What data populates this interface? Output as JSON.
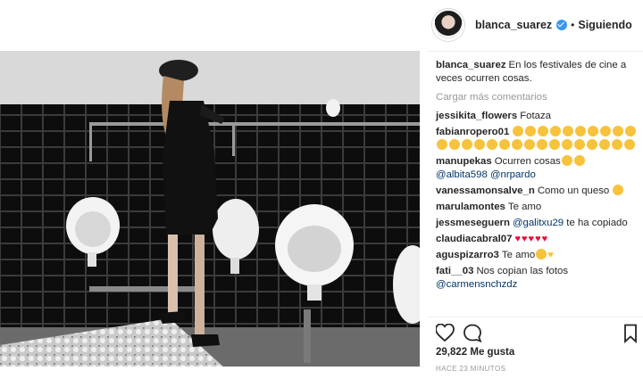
{
  "post": {
    "username": "blanca_suarez",
    "separator": "•",
    "follow_state": "Siguiendo",
    "caption_username": "blanca_suarez",
    "caption_text": "En los festivales de cine a veces ocurren cosas."
  },
  "load_more": "Cargar más comentarios",
  "comments": [
    {
      "user": "jessikita_flowers",
      "text": "Fotaza"
    },
    {
      "user": "fabianropero01",
      "emoji_count": 26,
      "emoji_name": "heart-eyes-emoji"
    },
    {
      "user": "manupekas",
      "text": "Ocurren cosas",
      "emoji_count": 2,
      "emoji_name": "laughing-emoji",
      "mentions": [
        "@albita598",
        "@nrpardo"
      ]
    },
    {
      "user": "vanessamonsalve_n",
      "text": "Como un queso",
      "emoji_count": 1,
      "emoji_name": "heart-eyes-emoji"
    },
    {
      "user": "marulamontes",
      "text": "Te amo"
    },
    {
      "user": "jessmeseguern",
      "mention": "@galitxu29",
      "text": "te ha copiado"
    },
    {
      "user": "claudiacabral07",
      "heart_count": 5,
      "heart_name": "red-heart-emoji"
    },
    {
      "user": "aguspizarro3",
      "text": "Te amo",
      "emoji_name": "heart-eyes-emoji",
      "heart_name": "yellow-heart-emoji"
    },
    {
      "user": "fati__03",
      "text": "Nos copian las fotos",
      "mention": "@carmensnchzdz"
    }
  ],
  "actions": {
    "like_icon": "heart-outline-icon",
    "comment_icon": "comment-bubble-icon",
    "save_icon": "bookmark-icon"
  },
  "likes": "29,822 Me gusta",
  "time_ago": "HACE 23 MINUTOS",
  "colors": {
    "link_blue": "#003569",
    "muted": "#999999",
    "verified": "#3897f0",
    "text": "#262626"
  }
}
